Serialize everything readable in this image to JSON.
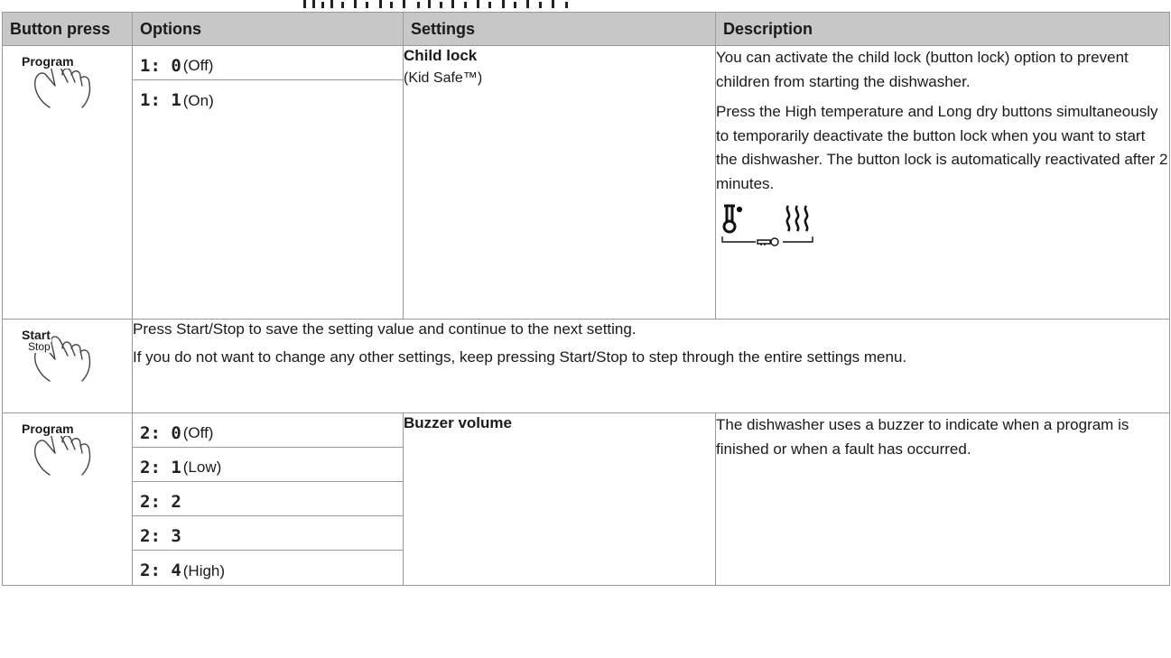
{
  "header": {
    "col_button_press": "Button press",
    "col_options": "Options",
    "col_settings": "Settings",
    "col_description": "Description"
  },
  "rows": [
    {
      "button": "Program",
      "options": [
        {
          "code": "1:  0",
          "label": "(Off)"
        },
        {
          "code": "1:  1",
          "label": "(On)"
        }
      ],
      "setting_title": "Child lock",
      "setting_subtitle": "(Kid Safe™)",
      "description": [
        "You can activate the child lock (button lock) option to prevent children from starting the dishwasher.",
        "Press the High temperature and Long dry buttons simultaneously to temporarily deactivate the button lock when you want to start the dishwasher. The button lock is automatically reactivated after 2 minutes."
      ],
      "icons": [
        "thermometer-icon",
        "heat-waves-icon",
        "key-icon"
      ]
    },
    {
      "button": "Start",
      "button_sub": "Stop",
      "lines": [
        "Press Start/Stop to save the setting value and continue to the next setting.",
        "If you do not want to change any other settings, keep pressing Start/Stop to step through the entire settings menu."
      ]
    },
    {
      "button": "Program",
      "options": [
        {
          "code": "2:  0",
          "label": "(Off)"
        },
        {
          "code": "2:  1",
          "label": "(Low)"
        },
        {
          "code": "2:  2",
          "label": ""
        },
        {
          "code": "2:  3",
          "label": ""
        },
        {
          "code": "2:  4",
          "label": "(High)"
        }
      ],
      "setting_title": "Buzzer volume",
      "description": [
        "The dishwasher uses a buzzer to indicate when a program is finished or when a fault has occurred."
      ]
    }
  ]
}
